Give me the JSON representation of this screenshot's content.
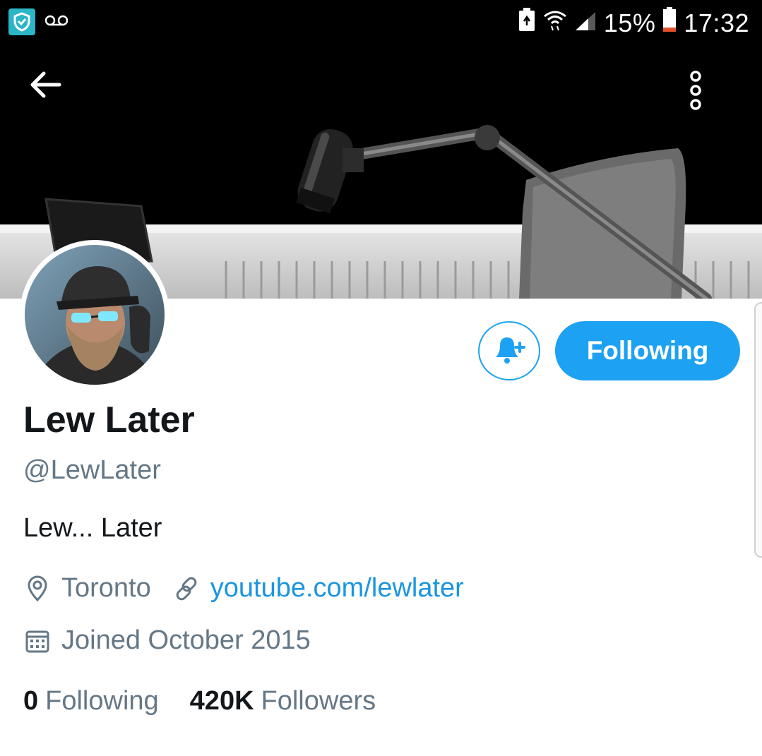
{
  "status_bar": {
    "battery_percent": "15%",
    "time": "17:32",
    "icons": [
      "shield-app-icon",
      "voicemail-icon",
      "battery-saver-icon",
      "wifi-icon",
      "signal-icon",
      "battery-icon"
    ]
  },
  "banner": {
    "icons": {
      "back": "arrow-left-icon",
      "more": "more-vertical-icon"
    }
  },
  "profile": {
    "display_name": "Lew Later",
    "handle": "@LewLater",
    "bio": "Lew... Later",
    "location": "Toronto",
    "website": "youtube.com/lewlater",
    "joined": "Joined October 2015"
  },
  "actions": {
    "notify_icon": "bell-plus-icon",
    "following_label": "Following"
  },
  "stats": {
    "following_count": "0",
    "following_label": "Following",
    "followers_count": "420K",
    "followers_label": "Followers"
  },
  "colors": {
    "accent": "#1da1f2",
    "link": "#1b95e0",
    "muted": "#657786",
    "text": "#14171a"
  }
}
